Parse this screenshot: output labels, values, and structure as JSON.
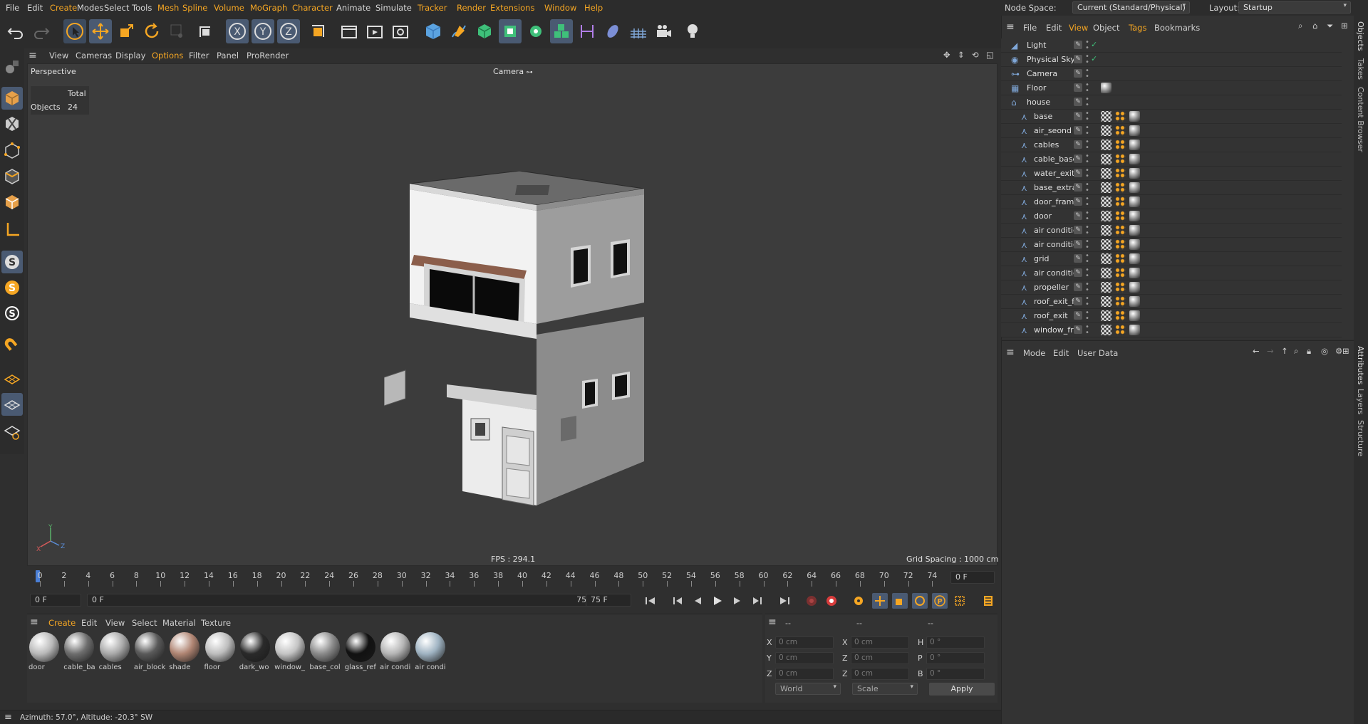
{
  "menubar": {
    "items": [
      "File",
      "Edit",
      "Create",
      "Modes",
      "Select",
      "Tools",
      "Mesh",
      "Spline",
      "Volume",
      "MoGraph",
      "Character",
      "Animate",
      "Simulate",
      "Tracker",
      "Render",
      "Extensions",
      "Window",
      "Help"
    ],
    "node_space_label": "Node Space:",
    "node_space_value": "Current (Standard/Physical)",
    "layout_label": "Layout:",
    "layout_value": "Startup"
  },
  "viewport": {
    "menu": [
      "View",
      "Cameras",
      "Display",
      "Options",
      "Filter",
      "Panel",
      "ProRender"
    ],
    "name": "Perspective",
    "camera_label": "Camera",
    "stats_header": "Total",
    "stats_label": "Objects",
    "stats_value": "24",
    "fps": "FPS : 294.1",
    "grid_spacing": "Grid Spacing : 1000 cm",
    "axis_y": "Y",
    "axis_x": "X",
    "axis_z": "Z"
  },
  "timeline": {
    "ticks": [
      "0",
      "2",
      "4",
      "6",
      "8",
      "10",
      "12",
      "14",
      "16",
      "18",
      "20",
      "22",
      "24",
      "26",
      "28",
      "30",
      "32",
      "34",
      "36",
      "38",
      "40",
      "42",
      "44",
      "46",
      "48",
      "50",
      "52",
      "54",
      "56",
      "58",
      "60",
      "62",
      "64",
      "66",
      "68",
      "70",
      "72",
      "74"
    ],
    "current_frame": "0 F",
    "start_frame": "0 F",
    "range_start": "0 F",
    "range_end": "75 F",
    "end_frame": "75 F"
  },
  "materials": {
    "menu": [
      "Create",
      "Edit",
      "View",
      "Select",
      "Material",
      "Texture"
    ],
    "items": [
      {
        "name": "door",
        "color": "#b9b9b9"
      },
      {
        "name": "cable_ba",
        "color": "#6e6e6e"
      },
      {
        "name": "cables",
        "color": "#a9a9a9"
      },
      {
        "name": "air_block",
        "color": "#5a5a5a"
      },
      {
        "name": "shade",
        "color": "#b08573"
      },
      {
        "name": "floor",
        "color": "#bdbdbd"
      },
      {
        "name": "dark_wo",
        "color": "#2a2a2a"
      },
      {
        "name": "window_",
        "color": "#c4c4c4"
      },
      {
        "name": "base_col",
        "color": "#8a8a8a"
      },
      {
        "name": "glass_ref",
        "color": "#111111"
      },
      {
        "name": "air condi",
        "color": "#b5b5b5"
      },
      {
        "name": "air condi",
        "color": "#9fb3c2"
      }
    ]
  },
  "coordinates": {
    "header": [
      "--",
      "--",
      "--"
    ],
    "rows": [
      {
        "l1": "X",
        "v1": "0 cm",
        "l2": "X",
        "v2": "0 cm",
        "l3": "H",
        "v3": "0 °"
      },
      {
        "l1": "Y",
        "v1": "0 cm",
        "l2": "Z",
        "v2": "0 cm",
        "l3": "P",
        "v3": "0 °"
      },
      {
        "l1": "Z",
        "v1": "0 cm",
        "l2": "Z",
        "v2": "0 cm",
        "l3": "B",
        "v3": "0 °"
      }
    ],
    "mode": "World",
    "transform": "Scale",
    "apply": "Apply"
  },
  "status": "Azimuth: 57.0°, Altitude: -20.3°  SW",
  "objects": {
    "menu": [
      "File",
      "Edit",
      "View",
      "Object",
      "Tags",
      "Bookmarks"
    ],
    "rows": [
      {
        "name": "Light"
      },
      {
        "name": "Physical Sky"
      },
      {
        "name": "Camera"
      },
      {
        "name": "Floor"
      },
      {
        "name": "house"
      },
      {
        "name": "base"
      },
      {
        "name": "air_seond"
      },
      {
        "name": "cables"
      },
      {
        "name": "cable_base"
      },
      {
        "name": "water_exit"
      },
      {
        "name": "base_extra"
      },
      {
        "name": "door_fram"
      },
      {
        "name": "door"
      },
      {
        "name": "air conditic"
      },
      {
        "name": "air conditic"
      },
      {
        "name": "grid"
      },
      {
        "name": "air conditic"
      },
      {
        "name": "propeller"
      },
      {
        "name": "roof_exit_f"
      },
      {
        "name": "roof_exit"
      },
      {
        "name": "window_fr"
      }
    ]
  },
  "attributes": {
    "menu": [
      "Mode",
      "Edit",
      "User Data"
    ]
  },
  "right_tabs": [
    "Objects",
    "Takes",
    "Content Browser",
    "Attributes",
    "Layers",
    "Structure"
  ],
  "colors": {
    "accent": "#f5a623",
    "active_blue": "#4a5a72",
    "background": "#2f2f2f",
    "viewport": "#3c3c3c"
  }
}
